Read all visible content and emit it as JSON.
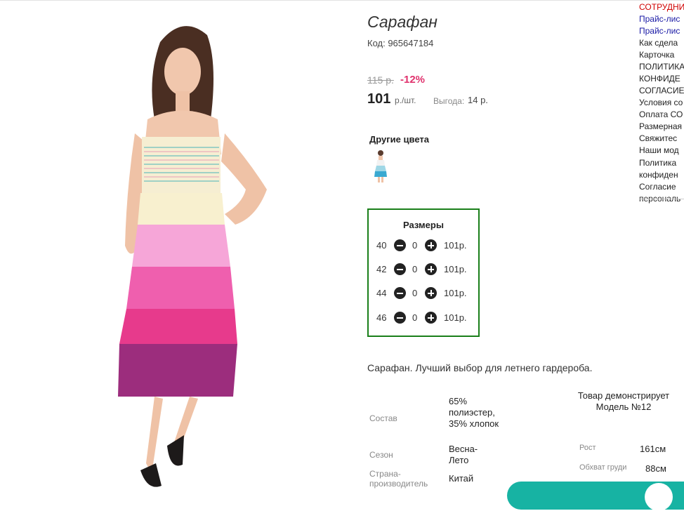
{
  "product": {
    "title": "Сарафан",
    "code": "Код: 965647184",
    "old_price": "115 р.",
    "discount": "-12%",
    "price": "101",
    "price_unit": "р./шт.",
    "benefit_label": "Выгода:",
    "benefit_value": "14 р.",
    "other_colors_label": "Другие цвета",
    "description": "Сарафан. Лучший выбор для летнего гардероба."
  },
  "sizes": {
    "title": "Размеры",
    "rows": [
      {
        "size": "40",
        "qty": "0",
        "price": "101р."
      },
      {
        "size": "42",
        "qty": "0",
        "price": "101р."
      },
      {
        "size": "44",
        "qty": "0",
        "price": "101р."
      },
      {
        "size": "46",
        "qty": "0",
        "price": "101р."
      }
    ]
  },
  "specs": [
    {
      "label": "Состав",
      "value": "65% полиэстер, 35% хлопок"
    },
    {
      "label": "Сезон",
      "value": "Весна-Лето"
    },
    {
      "label": "Страна-производитель",
      "value": "Китай"
    }
  ],
  "model": {
    "title": "Товар демонстрирует Модель №12",
    "rows": [
      {
        "label": "Рост",
        "value": "161см"
      },
      {
        "label": "Обхват груди",
        "value": "88см"
      }
    ]
  },
  "sidebar": {
    "items": [
      {
        "label": "СОТРУДНИ",
        "color": "red"
      },
      {
        "label": "Прайс-лис",
        "color": "blue"
      },
      {
        "label": "Прайс-лис",
        "color": "blue"
      },
      {
        "label": "Как сдела",
        "color": "dark"
      },
      {
        "label": "Карточка",
        "color": "dark"
      },
      {
        "label": "ПОЛИТИКА",
        "color": "dark"
      },
      {
        "label": "КОНФИДЕ",
        "color": "dark"
      },
      {
        "label": "СОГЛАСИЕ",
        "color": "dark"
      },
      {
        "label": "Условия со",
        "color": "dark"
      },
      {
        "label": "Оплата СО",
        "color": "dark"
      },
      {
        "label": "Размерная",
        "color": "dark"
      },
      {
        "label": "Свяжитес",
        "color": "dark"
      },
      {
        "label": "Наши мод",
        "color": "dark"
      },
      {
        "label": "Политика",
        "color": "dark"
      },
      {
        "label": "конфиден",
        "color": "dark"
      },
      {
        "label": "Согласие",
        "color": "dark"
      },
      {
        "label": "персональ",
        "color": "dark"
      }
    ]
  },
  "colors": {
    "accent_green": "#1a7f1a",
    "discount_pink": "#e0326d",
    "chat_teal": "#17b3a3",
    "link_blue": "#1a1aa6",
    "link_red": "#d00000"
  }
}
